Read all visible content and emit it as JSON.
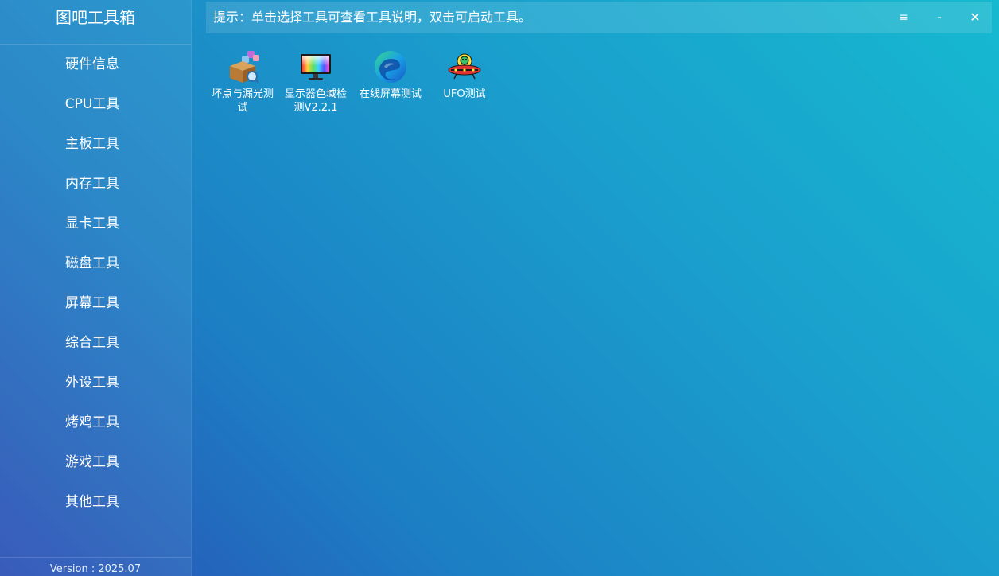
{
  "app": {
    "title": "图吧工具箱",
    "version": "Version : 2025.07"
  },
  "sidebar": {
    "items": [
      {
        "label": "硬件信息"
      },
      {
        "label": "CPU工具"
      },
      {
        "label": "主板工具"
      },
      {
        "label": "内存工具"
      },
      {
        "label": "显卡工具"
      },
      {
        "label": "磁盘工具"
      },
      {
        "label": "屏幕工具"
      },
      {
        "label": "综合工具"
      },
      {
        "label": "外设工具"
      },
      {
        "label": "烤鸡工具"
      },
      {
        "label": "游戏工具"
      },
      {
        "label": "其他工具"
      }
    ]
  },
  "hint": {
    "text": "提示：单击选择工具可查看工具说明，双击可启动工具。"
  },
  "window_controls": {
    "menu": "≡",
    "minimize": "-",
    "close": "✕"
  },
  "tools": [
    {
      "label": "坏点与漏光测试",
      "icon": "box-magnifier-icon"
    },
    {
      "label": "显示器色域检测V2.2.1",
      "icon": "monitor-gradient-icon"
    },
    {
      "label": "在线屏幕测试",
      "icon": "edge-browser-icon"
    },
    {
      "label": "UFO测试",
      "icon": "ufo-icon"
    }
  ]
}
